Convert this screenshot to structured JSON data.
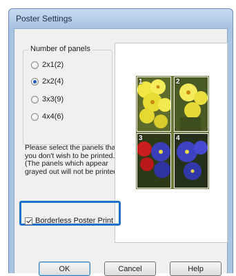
{
  "window": {
    "title": "Poster Settings"
  },
  "panels_group": {
    "legend": "Number of panels",
    "options": [
      {
        "label": "2x1(2)",
        "selected": false
      },
      {
        "label": "2x2(4)",
        "selected": true
      },
      {
        "label": "3x3(9)",
        "selected": false
      },
      {
        "label": "4x4(6)",
        "selected": false
      }
    ]
  },
  "instructions": "Please select the panels that you don't wish to be printed. (The panels which appear grayed out will not be printed)",
  "preview": {
    "panels": [
      {
        "number": "1"
      },
      {
        "number": "2"
      },
      {
        "number": "3"
      },
      {
        "number": "4"
      }
    ]
  },
  "borderless": {
    "label": "Borderless Poster Print",
    "checked": true
  },
  "buttons": {
    "ok": "OK",
    "cancel": "Cancel",
    "help": "Help"
  },
  "colors": {
    "highlight": "#1a73c6",
    "window_frame": "#a9c3e3"
  }
}
